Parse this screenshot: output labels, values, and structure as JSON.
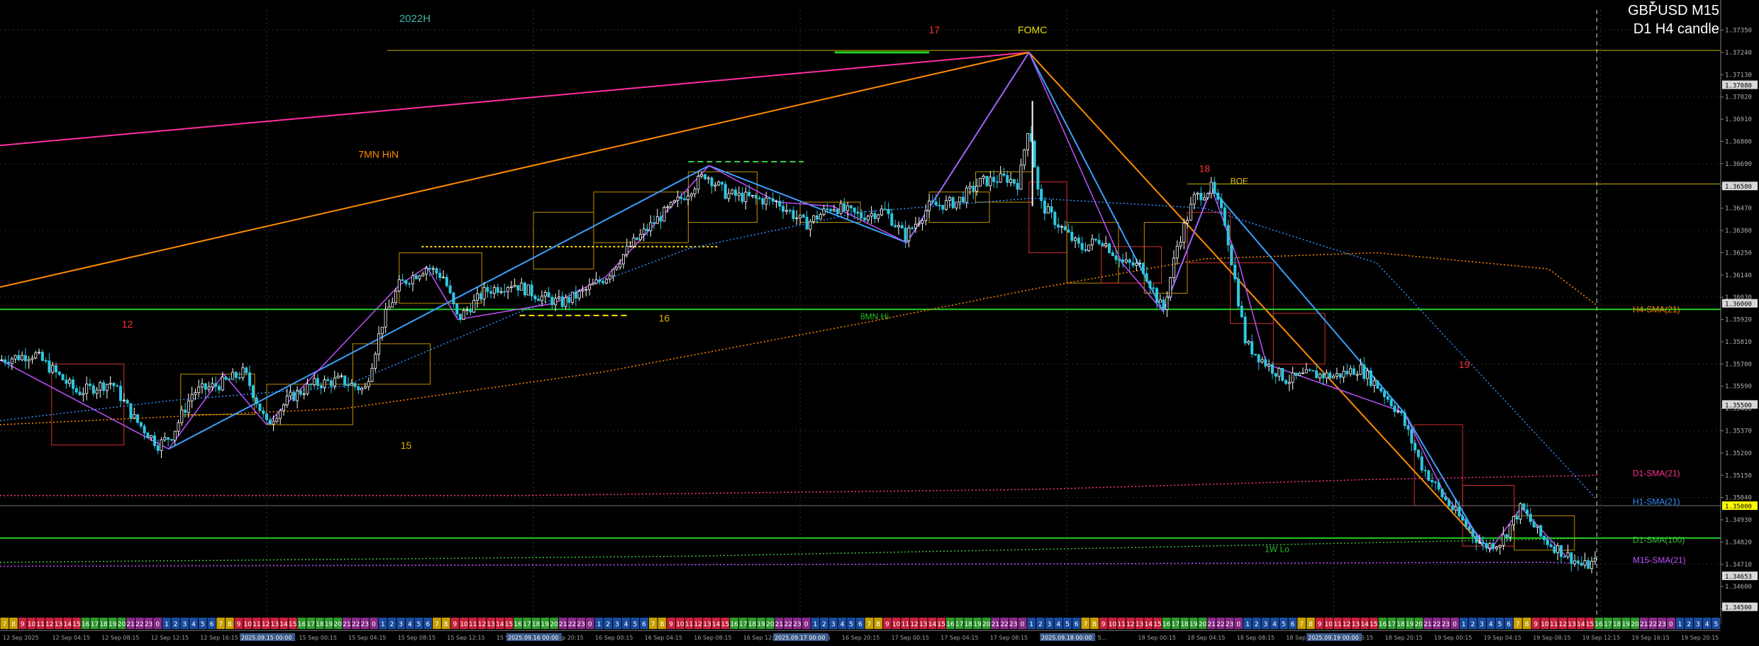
{
  "window": {
    "symbol_title": "GBPUSD M15",
    "subtitle": "D1 H4 candle"
  },
  "chart_data": {
    "type": "candlestick",
    "symbol": "GBPUSD",
    "timeframe": "M15",
    "ylim": [
      1.3445,
      1.3745
    ],
    "price_ticks": [
      "1.37350",
      "1.37240",
      "1.37130",
      "1.37020",
      "1.36910",
      "1.36800",
      "1.36690",
      "1.36580",
      "1.36470",
      "1.36360",
      "1.36250",
      "1.36140",
      "1.36030",
      "1.35920",
      "1.35810",
      "1.35700",
      "1.35590",
      "1.35480",
      "1.35370",
      "1.35260",
      "1.35150",
      "1.35040",
      "1.34930",
      "1.34820",
      "1.34710",
      "1.34600",
      "1.34490"
    ],
    "price_badges": [
      {
        "label": "1.37080",
        "value": 1.3708,
        "color": "#d8d8d8"
      },
      {
        "label": "1.36580",
        "value": 1.3658,
        "color": "#d8d8d8"
      },
      {
        "label": "1.36000",
        "value": 1.36,
        "color": "#d8d8d8"
      },
      {
        "label": "1.35500",
        "value": 1.355,
        "color": "#d8d8d8"
      },
      {
        "label": "1.35000",
        "value": 1.35,
        "color": "#ffff00"
      },
      {
        "label": "1.34653",
        "value": 1.34653,
        "color": "#d8d8d8"
      },
      {
        "label": "1.34500",
        "value": 1.345,
        "color": "#d8d8d8"
      }
    ],
    "time_ticks": [
      "12 Sep 2025",
      "12 Sep 04:15",
      "12 Sep 08:15",
      "12 Sep 12:15",
      "12 Sep 16:15",
      "12 S...",
      "15 Sep 00:15",
      "15 Sep 04:15",
      "15 Sep 08:15",
      "15 Sep 12:15",
      "15 Sep 16:15",
      "15 Sep 20:15",
      "16 Sep 00:15",
      "16 Sep 04:15",
      "16 Sep 08:15",
      "16 Sep 12:15",
      "16 Sep 16:15",
      "16 Sep 20:15",
      "17 Sep 00:15",
      "17 Sep 04:15",
      "17 Sep 08:15",
      "17 Sep 12:15",
      "17 S...",
      "18 Sep 00:15",
      "18 Sep 04:15",
      "18 Sep 08:15",
      "18 Sep 12:15",
      "18 Sep 16:15",
      "18 Sep 20:15",
      "19 Sep 00:15",
      "19 Sep 04:15",
      "19 Sep 08:15",
      "19 Sep 12:15",
      "19 Sep 16:15",
      "19 Sep 20:15"
    ],
    "time_tick_highlights": [
      "2025.09.15 00:00",
      "2025.09.16 00:00",
      "2025.09.17 00:00",
      "2025.09.18 00:00",
      "2025.09.19 00:00"
    ],
    "hour_strip": [
      "7",
      "8",
      "9",
      "10",
      "11",
      "12",
      "13",
      "14",
      "15",
      "16",
      "17",
      "18",
      "19",
      "20",
      "21",
      "22",
      "23",
      "0",
      "1",
      "2",
      "3",
      "4",
      "5",
      "6"
    ],
    "horizontal_levels": [
      {
        "value": 1.3725,
        "color": "#c8b400",
        "label": "2022H",
        "label_color": "#3fb3a8"
      },
      {
        "value": 1.3659,
        "color": "#c8b400",
        "label": "BOE",
        "label_color": "#e0c020"
      },
      {
        "value": 1.3597,
        "color": "#20d020",
        "label": "8MN Hi",
        "label_color": "#20c020"
      },
      {
        "value": 1.3484,
        "color": "#20d020",
        "label": "1W Lo",
        "label_color": "#20c020"
      },
      {
        "value": 1.35,
        "color": "#707070",
        "label": "",
        "label_color": "#ffffff"
      }
    ],
    "labels": [
      {
        "text": "7MN HiN",
        "color": "#ff8c00",
        "time": 0.22,
        "price": 1.3672
      },
      {
        "text": "FOMC",
        "color": "#e8e000",
        "time": 0.6,
        "price": 1.37335
      },
      {
        "text": "12",
        "color": "#ff3030",
        "time": 0.074,
        "price": 1.3588
      },
      {
        "text": "15",
        "color": "#e0b000",
        "time": 0.236,
        "price": 1.3528
      },
      {
        "text": "16",
        "color": "#e0b000",
        "time": 0.386,
        "price": 1.3591
      },
      {
        "text": "17",
        "color": "#ff3030",
        "time": 0.543,
        "price": 1.37335
      },
      {
        "text": "18",
        "color": "#ff3030",
        "time": 0.7,
        "price": 1.3665
      },
      {
        "text": "19",
        "color": "#ff3030",
        "time": 0.851,
        "price": 1.3568
      }
    ],
    "ma_labels": [
      {
        "text": "H4-SMA(21)",
        "color": "#ff8c00"
      },
      {
        "text": "D1-SMA(21)",
        "color": "#ff3090"
      },
      {
        "text": "H1-SMA(21)",
        "color": "#3090ff"
      },
      {
        "text": "D1-SMA(100)",
        "color": "#40c040"
      },
      {
        "text": "M15-SMA(21)",
        "color": "#c050ff"
      }
    ],
    "price_path": [
      [
        0.0,
        1.3572
      ],
      [
        0.02,
        1.3575
      ],
      [
        0.045,
        1.3556
      ],
      [
        0.065,
        1.3561
      ],
      [
        0.078,
        1.3543
      ],
      [
        0.092,
        1.353
      ],
      [
        0.1,
        1.3535
      ],
      [
        0.112,
        1.3556
      ],
      [
        0.128,
        1.356
      ],
      [
        0.142,
        1.3566
      ],
      [
        0.155,
        1.354
      ],
      [
        0.168,
        1.3553
      ],
      [
        0.182,
        1.356
      ],
      [
        0.198,
        1.3562
      ],
      [
        0.212,
        1.3557
      ],
      [
        0.222,
        1.359
      ],
      [
        0.232,
        1.3609
      ],
      [
        0.248,
        1.3618
      ],
      [
        0.258,
        1.3613
      ],
      [
        0.266,
        1.3592
      ],
      [
        0.282,
        1.3606
      ],
      [
        0.298,
        1.361
      ],
      [
        0.312,
        1.3604
      ],
      [
        0.326,
        1.36
      ],
      [
        0.338,
        1.3605
      ],
      [
        0.352,
        1.3613
      ],
      [
        0.366,
        1.3628
      ],
      [
        0.38,
        1.364
      ],
      [
        0.396,
        1.3652
      ],
      [
        0.41,
        1.3664
      ],
      [
        0.422,
        1.3654
      ],
      [
        0.436,
        1.3652
      ],
      [
        0.452,
        1.365
      ],
      [
        0.468,
        1.3639
      ],
      [
        0.484,
        1.3648
      ],
      [
        0.5,
        1.3643
      ],
      [
        0.514,
        1.3646
      ],
      [
        0.526,
        1.3633
      ],
      [
        0.54,
        1.3648
      ],
      [
        0.556,
        1.365
      ],
      [
        0.57,
        1.366
      ],
      [
        0.585,
        1.3662
      ],
      [
        0.592,
        1.3659
      ],
      [
        0.598,
        1.369
      ],
      [
        0.604,
        1.365
      ],
      [
        0.614,
        1.364
      ],
      [
        0.628,
        1.3627
      ],
      [
        0.64,
        1.3632
      ],
      [
        0.652,
        1.362
      ],
      [
        0.664,
        1.3618
      ],
      [
        0.676,
        1.3596
      ],
      [
        0.684,
        1.3628
      ],
      [
        0.694,
        1.3652
      ],
      [
        0.704,
        1.3657
      ],
      [
        0.712,
        1.364
      ],
      [
        0.724,
        1.358
      ],
      [
        0.736,
        1.357
      ],
      [
        0.748,
        1.3562
      ],
      [
        0.762,
        1.3565
      ],
      [
        0.776,
        1.3564
      ],
      [
        0.79,
        1.3568
      ],
      [
        0.802,
        1.3558
      ],
      [
        0.814,
        1.3545
      ],
      [
        0.826,
        1.352
      ],
      [
        0.838,
        1.3505
      ],
      [
        0.852,
        1.349
      ],
      [
        0.862,
        1.348
      ],
      [
        0.872,
        1.3482
      ],
      [
        0.884,
        1.3499
      ],
      [
        0.896,
        1.3484
      ],
      [
        0.908,
        1.3477
      ],
      [
        0.92,
        1.347
      ],
      [
        0.928,
        1.3472
      ]
    ],
    "moving_averages": [
      {
        "name": "H4-SMA(21)",
        "color": "#ff8c00",
        "points": [
          [
            0.0,
            1.354
          ],
          [
            0.2,
            1.3548
          ],
          [
            0.35,
            1.3566
          ],
          [
            0.5,
            1.359
          ],
          [
            0.6,
            1.3607
          ],
          [
            0.7,
            1.3622
          ],
          [
            0.8,
            1.3625
          ],
          [
            0.9,
            1.3617
          ],
          [
            0.928,
            1.3599
          ]
        ]
      },
      {
        "name": "D1-SMA(21)",
        "color": "#ff3090",
        "points": [
          [
            0.0,
            1.3505
          ],
          [
            0.3,
            1.3505
          ],
          [
            0.6,
            1.3508
          ],
          [
            0.8,
            1.3513
          ],
          [
            0.928,
            1.3515
          ]
        ]
      },
      {
        "name": "H1-SMA(21)",
        "color": "#3090ff",
        "points": [
          [
            0.0,
            1.3542
          ],
          [
            0.1,
            1.3552
          ],
          [
            0.2,
            1.3559
          ],
          [
            0.3,
            1.3595
          ],
          [
            0.4,
            1.3627
          ],
          [
            0.5,
            1.3645
          ],
          [
            0.6,
            1.3652
          ],
          [
            0.7,
            1.3647
          ],
          [
            0.8,
            1.362
          ],
          [
            0.88,
            1.3547
          ],
          [
            0.928,
            1.3503
          ]
        ]
      },
      {
        "name": "D1-SMA(100)",
        "color": "#40c040",
        "points": [
          [
            0.0,
            1.3472
          ],
          [
            0.4,
            1.3475
          ],
          [
            0.7,
            1.348
          ],
          [
            0.928,
            1.3484
          ]
        ]
      },
      {
        "name": "M15-SMA(21)",
        "color": "#c050ff",
        "points": [
          [
            0.0,
            1.347
          ],
          [
            0.5,
            1.3471
          ],
          [
            0.9,
            1.3472
          ],
          [
            0.928,
            1.3471
          ]
        ]
      }
    ],
    "trend_lines": [
      {
        "color": "#ff2fa0",
        "from": [
          0.0,
          1.3678
        ],
        "to": [
          0.598,
          1.3724
        ]
      },
      {
        "color": "#ff8c00",
        "from": [
          0.0,
          1.3608
        ],
        "to": [
          0.598,
          1.3724
        ]
      },
      {
        "color": "#ff8c00",
        "from": [
          0.598,
          1.3724
        ],
        "to": [
          0.862,
          1.348
        ]
      },
      {
        "color": "#3aa0ff",
        "from": [
          0.098,
          1.3528
        ],
        "to": [
          0.412,
          1.3668
        ]
      },
      {
        "color": "#3aa0ff",
        "from": [
          0.412,
          1.3668
        ],
        "to": [
          0.527,
          1.363
        ]
      },
      {
        "color": "#3aa0ff",
        "from": [
          0.527,
          1.363
        ],
        "to": [
          0.598,
          1.3724
        ]
      },
      {
        "color": "#3aa0ff",
        "from": [
          0.598,
          1.3724
        ],
        "to": [
          0.676,
          1.3596
        ]
      },
      {
        "color": "#3aa0ff",
        "from": [
          0.676,
          1.3596
        ],
        "to": [
          0.704,
          1.3657
        ]
      },
      {
        "color": "#3aa0ff",
        "from": [
          0.704,
          1.3657
        ],
        "to": [
          0.816,
          1.3546
        ]
      },
      {
        "color": "#3aa0ff",
        "from": [
          0.816,
          1.3546
        ],
        "to": [
          0.862,
          1.348
        ]
      }
    ]
  }
}
